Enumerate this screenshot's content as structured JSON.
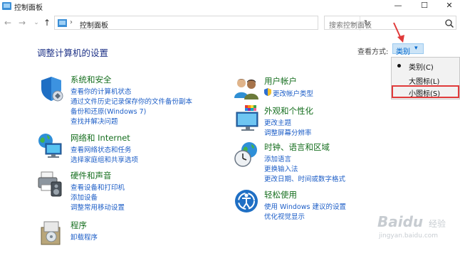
{
  "window": {
    "title": "控制面板",
    "min": "—",
    "max": "☐",
    "close": "✕"
  },
  "nav": {
    "back": "←",
    "forward": "→",
    "recent": "⌄",
    "up": "↑"
  },
  "address": {
    "separator": "›",
    "path": "控制面板",
    "dropdown": "⌄",
    "refresh": "↻"
  },
  "search": {
    "placeholder": "搜索控制面板"
  },
  "heading": "调整计算机的设置",
  "viewby": {
    "label": "查看方式:",
    "value": "类别",
    "caret": "▾"
  },
  "menu": {
    "items": [
      "类别(C)",
      "大图标(L)",
      "小图标(S)"
    ]
  },
  "categories": [
    {
      "title": "系统和安全",
      "links": [
        "查看你的计算机状态",
        "通过文件历史记录保存你的文件备份副本",
        "备份和还原(Windows 7)",
        "查找并解决问题"
      ]
    },
    {
      "title": "网络和 Internet",
      "links": [
        "查看网络状态和任务",
        "选择家庭组和共享选项"
      ]
    },
    {
      "title": "硬件和声音",
      "links": [
        "查看设备和打印机",
        "添加设备",
        "调整常用移动设置"
      ]
    },
    {
      "title": "程序",
      "links": [
        "卸载程序"
      ]
    },
    {
      "title": "用户帐户",
      "links": [
        "更改帐户类型"
      ]
    },
    {
      "title": "外观和个性化",
      "links": [
        "更改主题",
        "调整屏幕分辨率"
      ]
    },
    {
      "title": "时钟、语言和区域",
      "links": [
        "添加语言",
        "更换输入法",
        "更改日期、时间或数字格式"
      ]
    },
    {
      "title": "轻松使用",
      "links": [
        "使用 Windows 建议的设置",
        "优化视觉显示"
      ]
    }
  ],
  "watermark": {
    "brand": "Baidu",
    "sub": "经验",
    "url": "jingyan.baidu.com"
  },
  "colors": {
    "link": "#1d5ec7",
    "category_title": "#156e1e",
    "heading": "#1e3287",
    "highlight": "#e03a3a"
  }
}
